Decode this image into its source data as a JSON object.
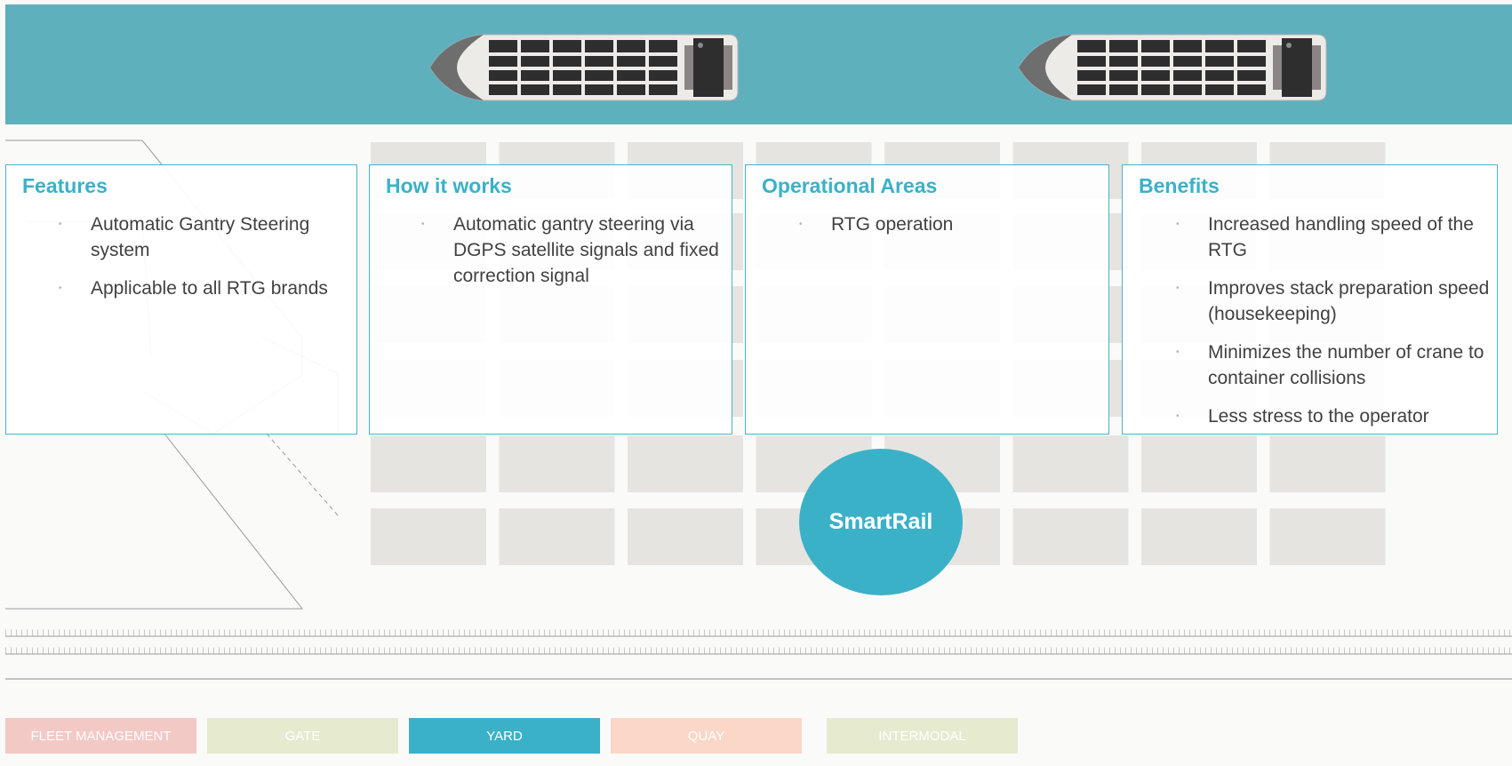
{
  "panels": {
    "features": {
      "title": "Features",
      "items": [
        "Automatic Gantry Steering system",
        "Applicable to all RTG brands"
      ]
    },
    "how_it_works": {
      "title": "How it works",
      "items": [
        "Automatic gantry steering via DGPS satellite signals and fixed correction signal"
      ]
    },
    "operational_areas": {
      "title": "Operational Areas",
      "items": [
        "RTG operation"
      ]
    },
    "benefits": {
      "title": "Benefits",
      "items": [
        "Increased handling speed of the RTG",
        "Improves stack preparation speed (housekeeping)",
        "Minimizes the number of crane to container collisions",
        "Less stress to the operator"
      ]
    }
  },
  "hub_label": "SmartRail",
  "tabs": [
    {
      "label": "FLEET MANAGEMENT",
      "color": "#f3c9c6",
      "active": false
    },
    {
      "label": "GATE",
      "color": "#e6ebcf",
      "active": false
    },
    {
      "label": "YARD",
      "color": "#3bb1c8",
      "active": true
    },
    {
      "label": "QUAY",
      "color": "#fad7c6",
      "active": false
    },
    {
      "label": "INTERMODAL",
      "color": "#e6ebcf",
      "active": false
    }
  ],
  "colors": {
    "accent": "#3bb1c8",
    "water": "#5fb0bd",
    "container": "#e6e4e1"
  }
}
